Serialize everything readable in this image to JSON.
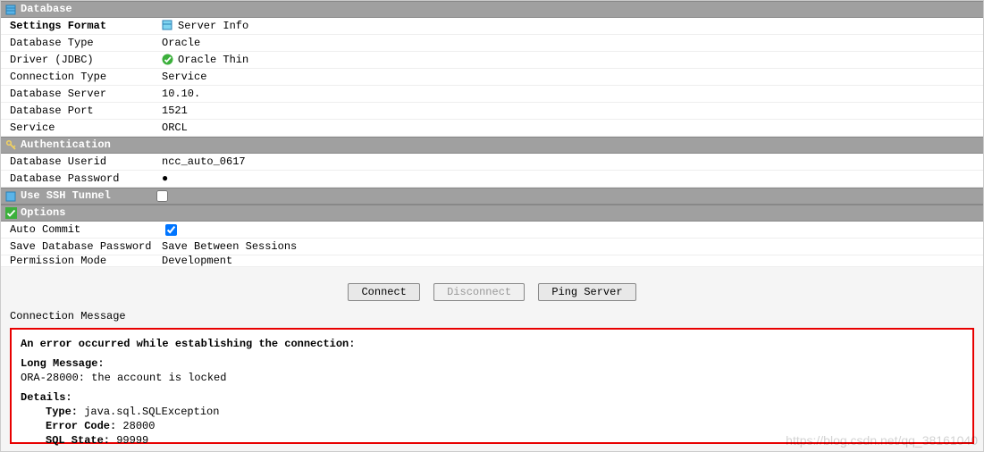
{
  "sections": {
    "database": {
      "title": "Database"
    },
    "auth": {
      "title": "Authentication"
    },
    "ssh": {
      "title": "Use SSH Tunnel"
    },
    "options": {
      "title": "Options"
    }
  },
  "db": {
    "settingsFormat": {
      "label": "Settings Format",
      "value": "Server Info"
    },
    "dbType": {
      "label": "Database Type",
      "value": "Oracle"
    },
    "driver": {
      "label": "Driver (JDBC)",
      "value": "Oracle Thin"
    },
    "connType": {
      "label": "Connection Type",
      "value": "Service"
    },
    "server": {
      "label": "Database Server",
      "value": "10.10."
    },
    "port": {
      "label": "Database Port",
      "value": "1521"
    },
    "service": {
      "label": "Service",
      "value": "ORCL"
    }
  },
  "auth": {
    "userid": {
      "label": "Database Userid",
      "value": "ncc_auto_0617"
    },
    "password": {
      "label": "Database Password",
      "value": "●"
    }
  },
  "ssh": {
    "checked": false
  },
  "opts": {
    "autoCommit": {
      "label": "Auto Commit",
      "checked": true
    },
    "savePwd": {
      "label": "Save Database Password",
      "value": "Save Between Sessions"
    },
    "permMode": {
      "label": "Permission Mode",
      "value": "Development"
    }
  },
  "buttons": {
    "connect": "Connect",
    "disconnect": "Disconnect",
    "ping": "Ping Server"
  },
  "msg": {
    "heading": "Connection Message",
    "title": "An error occurred while establishing the connection:",
    "longMsgH": "Long Message:",
    "longMsg": "ORA-28000: the account is locked",
    "detailsH": "Details:",
    "typeK": "Type:",
    "typeV": " java.sql.SQLException",
    "codeK": "Error Code:",
    "codeV": " 28000",
    "stateK": "SQL State:",
    "stateV": " 99999"
  },
  "watermark": "https://blog.csdn.net/qq_38161040"
}
